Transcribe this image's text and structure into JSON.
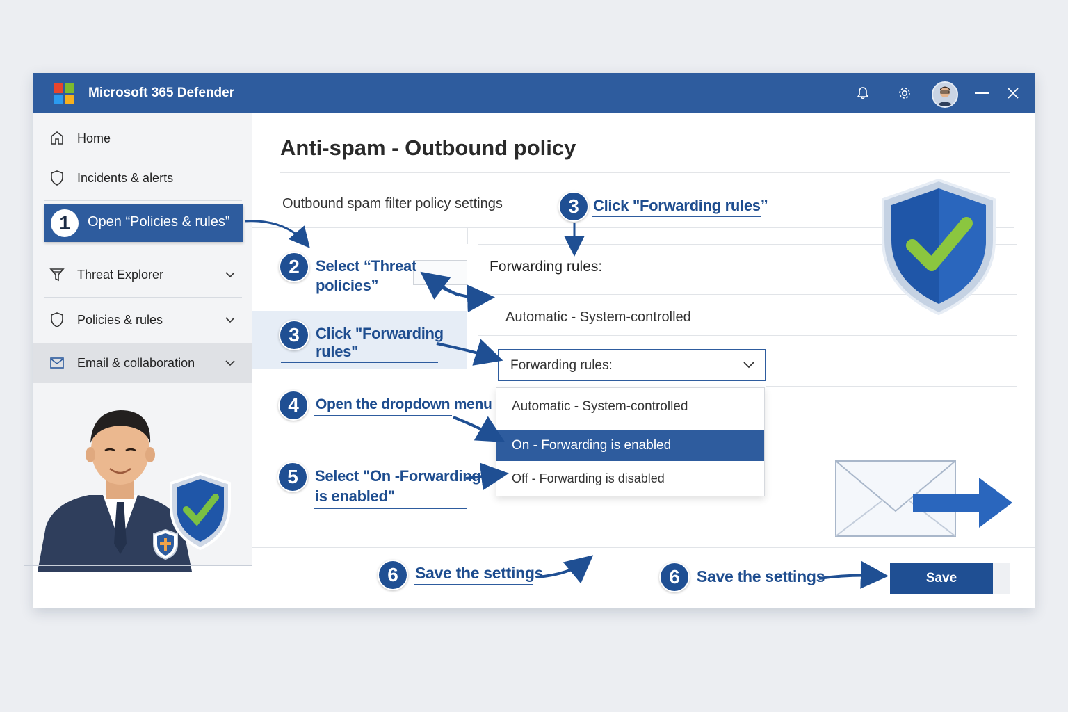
{
  "app": {
    "title": "Microsoft 365 Defender"
  },
  "titlebar": {
    "icons": [
      "bell-icon",
      "gear-icon",
      "user-avatar",
      "minimize-icon",
      "close-icon"
    ]
  },
  "sidebar": {
    "items": [
      {
        "label": "Home",
        "icon": "home-icon"
      },
      {
        "label": "Incidents & alerts",
        "icon": "shield-icon"
      },
      {
        "label": "Threat Explorer",
        "icon": "filter-icon"
      },
      {
        "label": "Policies & rules",
        "icon": "shield-icon"
      },
      {
        "label": "Email & collaboration",
        "icon": "mail-icon"
      }
    ],
    "step1": {
      "number": "1",
      "label": "Open “Policies & rules”"
    }
  },
  "main": {
    "title": "Anti-spam - Outbound policy",
    "subtitle": "Outbound spam filter policy settings",
    "forwarding_heading": "Forwarding rules:",
    "forwarding_current": "Automatic - System-controlled",
    "select": {
      "value": "Forwarding rules:"
    },
    "dropdown_options": [
      {
        "label": "Automatic - System-controlled",
        "selected": false
      },
      {
        "label": "On - Forwarding is enabled",
        "selected": true
      },
      {
        "label": "Off - Forwarding is disabled",
        "selected": false
      }
    ],
    "save_label": "Save"
  },
  "steps": {
    "s2": {
      "number": "2",
      "line1": "Select “Threat",
      "line2": "policies”"
    },
    "s3_left": {
      "number": "3",
      "line1": "Click \"Forwarding",
      "line2": "rules\""
    },
    "s3_top": {
      "number": "3",
      "text": "Click \"Forwarding rules”"
    },
    "s4": {
      "number": "4",
      "text": "Open the dropdown menu"
    },
    "s5": {
      "number": "5",
      "line1": "Select \"On -Forwarding",
      "line2": "is enabled\""
    },
    "s6a": {
      "number": "6",
      "text": "Save the settings"
    },
    "s6b": {
      "number": "6",
      "text": "Save the settings"
    }
  },
  "colors": {
    "brand": "#2e5c9e",
    "step_text": "#1e4d8f",
    "selected_option": "#2e5c9e",
    "check_green": "#7bc043"
  }
}
